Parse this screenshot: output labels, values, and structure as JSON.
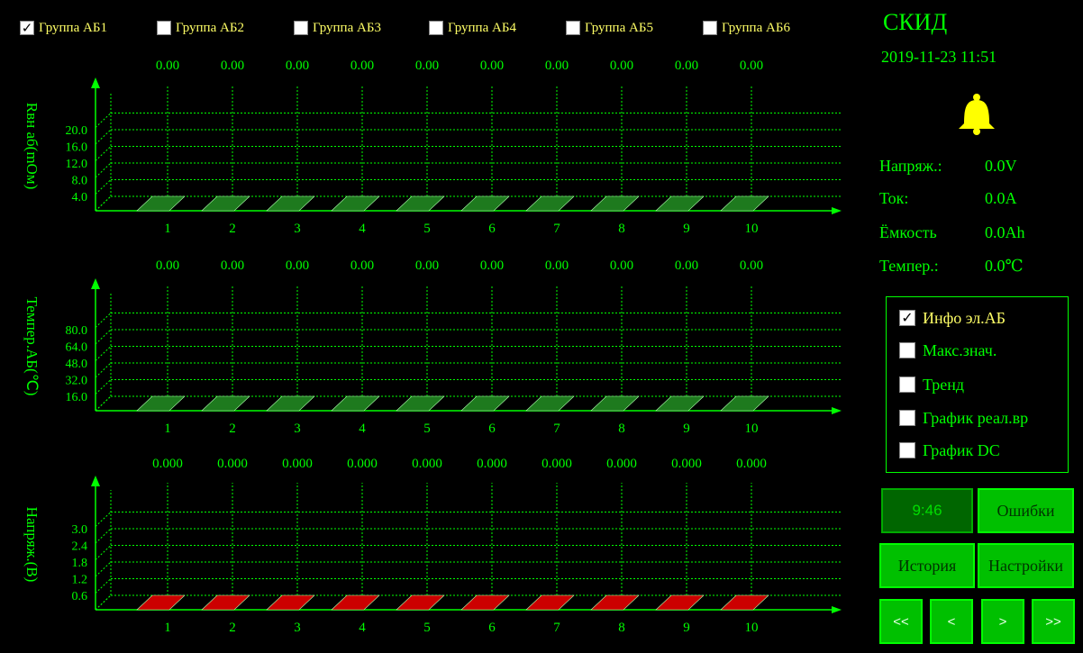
{
  "groups": [
    {
      "label": "Группа АБ1",
      "checked": true
    },
    {
      "label": "Группа АБ2",
      "checked": false
    },
    {
      "label": "Группа АБ3",
      "checked": false
    },
    {
      "label": "Группа АБ4",
      "checked": false
    },
    {
      "label": "Группа АБ5",
      "checked": false
    },
    {
      "label": "Группа АБ6",
      "checked": false
    }
  ],
  "header": {
    "title": "СКИД",
    "datetime": "2019-11-23 11:51"
  },
  "status": [
    {
      "label": "Напряж.:",
      "value": "0.0V"
    },
    {
      "label": "Ток:",
      "value": "0.0A"
    },
    {
      "label": "Ёмкость",
      "value": "0.0Ah"
    },
    {
      "label": "Темпер.:",
      "value": "0.0℃"
    }
  ],
  "options": [
    {
      "label": "Инфо эл.АБ",
      "checked": true
    },
    {
      "label": "Макс.знач.",
      "checked": false
    },
    {
      "label": "Тренд",
      "checked": false
    },
    {
      "label": "График реал.вр",
      "checked": false
    },
    {
      "label": "График DC",
      "checked": false
    }
  ],
  "buttons": {
    "time": "9:46",
    "errors": "Ошибки",
    "history": "История",
    "settings": "Настройки",
    "first": "<<",
    "prev": "<",
    "next": ">",
    "last": ">>"
  },
  "colors": {
    "accent": "#00ff00",
    "text_yellow": "#ffff66",
    "button": "#00c000",
    "bar_green": "#1e7a1e",
    "bar_red": "#cc0000"
  },
  "icons": {
    "alarm": "bell-icon"
  },
  "chart_data": [
    {
      "type": "bar",
      "ylabel": "Rвн аб(mOм)",
      "categories": [
        "1",
        "2",
        "3",
        "4",
        "5",
        "6",
        "7",
        "8",
        "9",
        "10"
      ],
      "values": [
        "0.00",
        "0.00",
        "0.00",
        "0.00",
        "0.00",
        "0.00",
        "0.00",
        "0.00",
        "0.00",
        "0.00"
      ],
      "yticks": [
        "20.0",
        "16.0",
        "12.0",
        "8.0",
        "4.0"
      ],
      "bar_color": "#1e7a1e"
    },
    {
      "type": "bar",
      "ylabel": "Темпер.АБ(℃)",
      "categories": [
        "1",
        "2",
        "3",
        "4",
        "5",
        "6",
        "7",
        "8",
        "9",
        "10"
      ],
      "values": [
        "0.00",
        "0.00",
        "0.00",
        "0.00",
        "0.00",
        "0.00",
        "0.00",
        "0.00",
        "0.00",
        "0.00"
      ],
      "yticks": [
        "80.0",
        "64.0",
        "48.0",
        "32.0",
        "16.0"
      ],
      "bar_color": "#1e7a1e"
    },
    {
      "type": "bar",
      "ylabel": "Напряж.(В)",
      "categories": [
        "1",
        "2",
        "3",
        "4",
        "5",
        "6",
        "7",
        "8",
        "9",
        "10"
      ],
      "values": [
        "0.000",
        "0.000",
        "0.000",
        "0.000",
        "0.000",
        "0.000",
        "0.000",
        "0.000",
        "0.000",
        "0.000"
      ],
      "yticks": [
        "3.0",
        "2.4",
        "1.8",
        "1.2",
        "0.6"
      ],
      "bar_color": "#cc0000"
    }
  ]
}
